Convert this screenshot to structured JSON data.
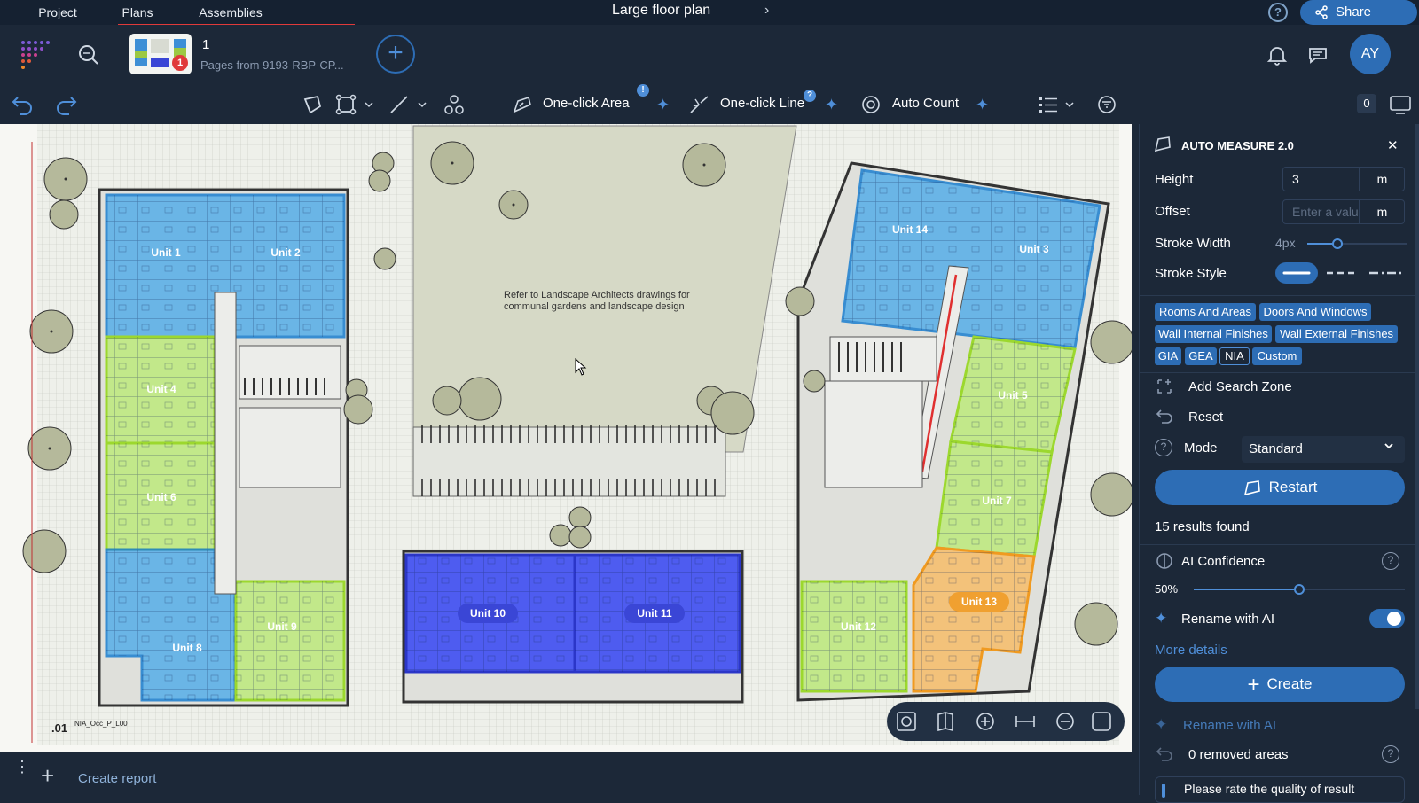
{
  "top_tabs": {
    "project": "Project",
    "plans": "Plans",
    "assemblies": "Assemblies"
  },
  "document": {
    "title": "Large floor plan",
    "share_label": "Share",
    "help_glyph": "?"
  },
  "header": {
    "page_number": "1",
    "page_subtitle": "Pages from 9193-RBP-CP...",
    "thumbnail_badge": "1",
    "avatar_initials": "AY",
    "add_glyph": "+"
  },
  "toolbar": {
    "one_click_area": "One-click Area",
    "one_click_line": "One-click Line",
    "auto_count": "Auto Count",
    "area_badge": "!",
    "line_badge": "?",
    "item_count": "0",
    "sparkle_glyph": "✦"
  },
  "canvas": {
    "annotation": "Refer to Landscape Architects drawings for communal gardens and landscape design",
    "floor_ref": ".01",
    "floor_ref_small": "NIA_Occ_P_L00",
    "units": [
      {
        "name": "Unit 1",
        "color": "#3d8fd6"
      },
      {
        "name": "Unit 2",
        "color": "#3d8fd6"
      },
      {
        "name": "Unit 4",
        "color": "#9cc942"
      },
      {
        "name": "Unit 6",
        "color": "#9cc942"
      },
      {
        "name": "Unit 8",
        "color": "#3d8fd6"
      },
      {
        "name": "Unit 9",
        "color": "#9cc942"
      },
      {
        "name": "Unit 10",
        "color": "#3a46d6"
      },
      {
        "name": "Unit 11",
        "color": "#3a46d6"
      },
      {
        "name": "Unit 12",
        "color": "#9cc942"
      },
      {
        "name": "Unit 13",
        "color": "#f0a030"
      },
      {
        "name": "Unit 14",
        "color": "#3d8fd6"
      },
      {
        "name": "Unit 3",
        "color": "#3d8fd6"
      },
      {
        "name": "Unit 5",
        "color": "#9cc942"
      },
      {
        "name": "Unit 7",
        "color": "#9cc942"
      }
    ]
  },
  "bottom_bar": {
    "create_report": "Create report",
    "menu_glyph": "⋮",
    "plus_glyph": "+"
  },
  "panel": {
    "title": "AUTO MEASURE 2.0",
    "close_glyph": "✕",
    "height_label": "Height",
    "height_value": "3",
    "height_unit": "m",
    "offset_label": "Offset",
    "offset_placeholder": "Enter a valu",
    "offset_unit": "m",
    "stroke_width_label": "Stroke Width",
    "stroke_width_value": "4px",
    "stroke_style_label": "Stroke Style",
    "chips": [
      "Rooms And Areas",
      "Doors And Windows",
      "Wall Internal Finishes",
      "Wall External Finishes",
      "GIA",
      "GEA",
      "NIA",
      "Custom"
    ],
    "add_search_zone": "Add Search Zone",
    "reset": "Reset",
    "mode_label": "Mode",
    "mode_value": "Standard",
    "restart": "Restart",
    "results": "15 results found",
    "ai_confidence": "AI Confidence",
    "confidence_value": "50%",
    "confidence_fraction": 0.5,
    "rename_ai": "Rename with AI",
    "rename_ai_on": true,
    "more_details": "More details",
    "create": "Create",
    "rename_ai_2": "Rename with AI",
    "removed_areas": "0 removed areas",
    "rate_prompt": "Please rate the quality of result",
    "help_glyph": "?"
  },
  "colors": {
    "accent": "#2d6db5",
    "panel_bg": "#1c2838",
    "alert": "#e03a3a"
  }
}
